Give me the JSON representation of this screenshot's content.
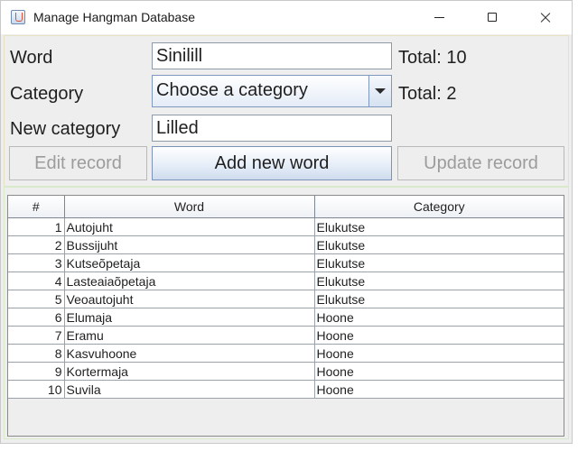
{
  "window": {
    "title": "Manage Hangman Database"
  },
  "form": {
    "word_label": "Word",
    "word_value": "Sinilill",
    "word_total": "Total: 10",
    "category_label": "Category",
    "category_selected": "Choose a category",
    "category_total": "Total: 2",
    "new_category_label": "New category",
    "new_category_value": "Lilled"
  },
  "buttons": {
    "edit": "Edit record",
    "add": "Add new word",
    "update": "Update record"
  },
  "table": {
    "headers": [
      "#",
      "Word",
      "Category"
    ],
    "rows": [
      [
        "1",
        "Autojuht",
        "Elukutse"
      ],
      [
        "2",
        "Bussijuht",
        "Elukutse"
      ],
      [
        "3",
        "Kutseõpetaja",
        "Elukutse"
      ],
      [
        "4",
        "Lasteaiaõpetaja",
        "Elukutse"
      ],
      [
        "5",
        "Veoautojuht",
        "Elukutse"
      ],
      [
        "6",
        "Elumaja",
        "Hoone"
      ],
      [
        "7",
        "Eramu",
        "Hoone"
      ],
      [
        "8",
        "Kasvuhoone",
        "Hoone"
      ],
      [
        "9",
        "Kortermaja",
        "Hoone"
      ],
      [
        "10",
        "Suvila",
        "Hoone"
      ]
    ]
  }
}
